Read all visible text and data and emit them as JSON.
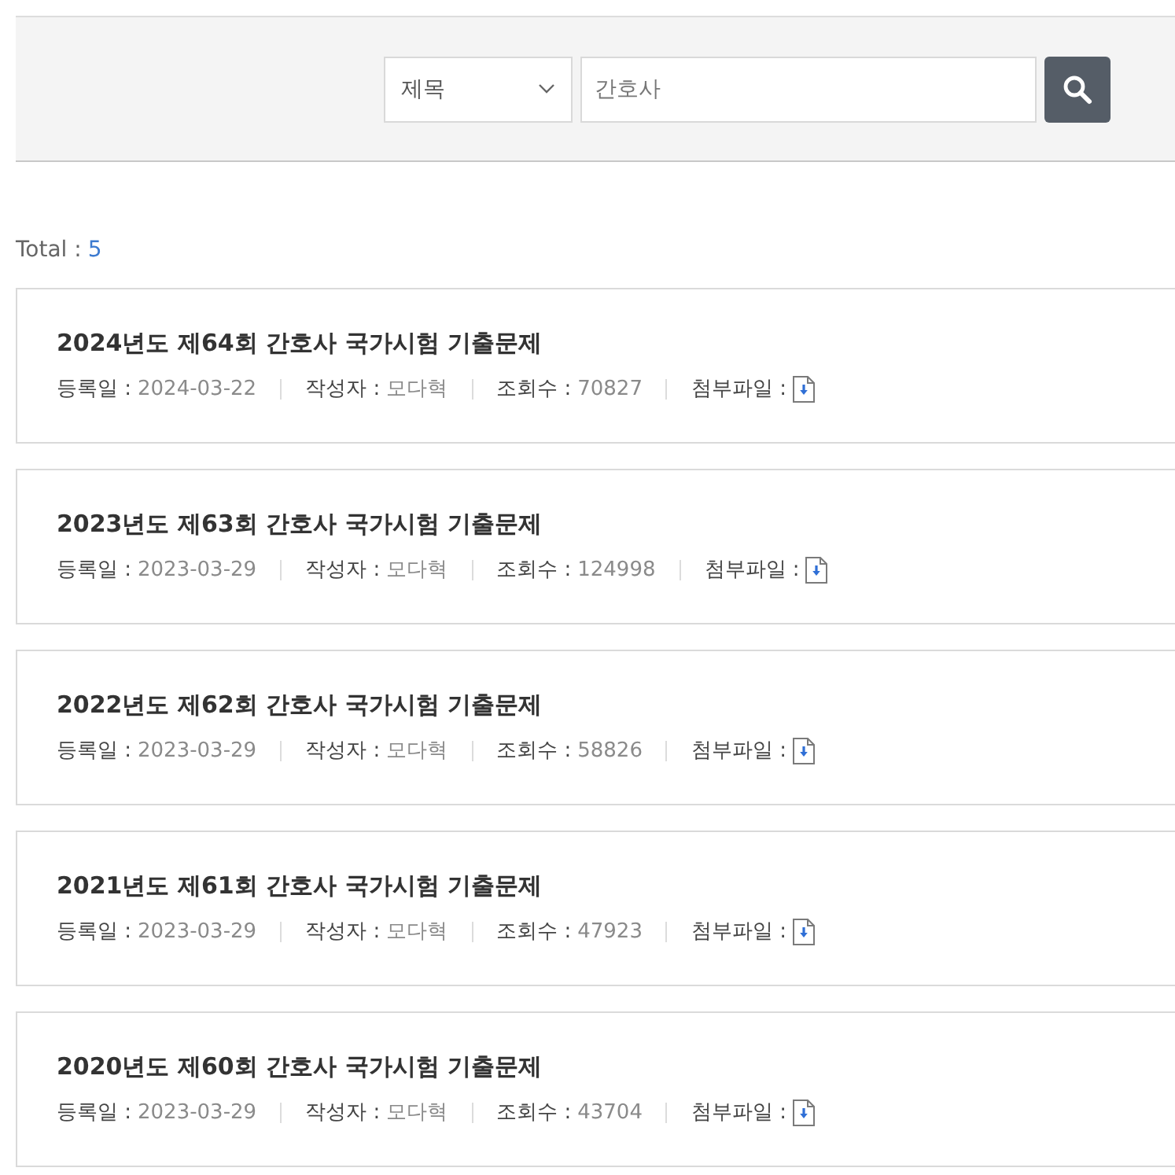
{
  "search": {
    "field": {
      "value": "제목"
    },
    "query": {
      "value": "간호사"
    }
  },
  "total": {
    "label": "Total :",
    "count": "5"
  },
  "posts": [
    {
      "title": "2024년도 제64회 간호사 국가시험 기출문제",
      "meta": [
        {
          "label": "등록일 :",
          "value": "2024-03-22"
        },
        {
          "label": "작성자 :",
          "value": "모다혁"
        },
        {
          "label": "조회수 :",
          "value": "70827"
        }
      ],
      "attachment": {
        "label": "첨부파일 :"
      }
    },
    {
      "title": "2023년도 제63회 간호사 국가시험 기출문제",
      "meta": [
        {
          "label": "등록일 :",
          "value": "2023-03-29"
        },
        {
          "label": "작성자 :",
          "value": "모다혁"
        },
        {
          "label": "조회수 :",
          "value": "124998"
        }
      ],
      "attachment": {
        "label": "첨부파일 :"
      }
    },
    {
      "title": "2022년도 제62회 간호사 국가시험 기출문제",
      "meta": [
        {
          "label": "등록일 :",
          "value": "2023-03-29"
        },
        {
          "label": "작성자 :",
          "value": "모다혁"
        },
        {
          "label": "조회수 :",
          "value": "58826"
        }
      ],
      "attachment": {
        "label": "첨부파일 :"
      }
    },
    {
      "title": "2021년도 제61회 간호사 국가시험 기출문제",
      "meta": [
        {
          "label": "등록일 :",
          "value": "2023-03-29"
        },
        {
          "label": "작성자 :",
          "value": "모다혁"
        },
        {
          "label": "조회수 :",
          "value": "47923"
        }
      ],
      "attachment": {
        "label": "첨부파일 :"
      }
    },
    {
      "title": "2020년도 제60회 간호사 국가시험 기출문제",
      "meta": [
        {
          "label": "등록일 :",
          "value": "2023-03-29"
        },
        {
          "label": "작성자 :",
          "value": "모다혁"
        },
        {
          "label": "조회수 :",
          "value": "43704"
        }
      ],
      "attachment": {
        "label": "첨부파일 :"
      }
    }
  ]
}
